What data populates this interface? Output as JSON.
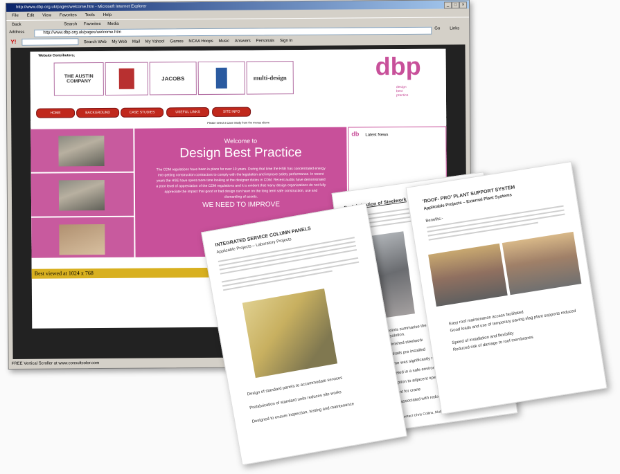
{
  "browser": {
    "title": "http://www.dbp.org.uk/pages/welcome.htm - Microsoft Internet Explorer",
    "menu": [
      "File",
      "Edit",
      "View",
      "Favorites",
      "Tools",
      "Help"
    ],
    "toolbar": [
      "Back",
      "Search",
      "Favorites",
      "Media"
    ],
    "address_label": "Address",
    "address_value": "http://www.dbp.org.uk/pages/welcome.htm",
    "go_label": "Go",
    "links_label": "Links",
    "yahoo_items": [
      "Search Web",
      "My Web",
      "Mail",
      "My Yahoo!",
      "Games",
      "NCAA Hoops",
      "Music",
      "Answers",
      "Personals",
      "Sign In"
    ],
    "status": "FREE Vertical Scroller at www.consultcolor.com"
  },
  "site": {
    "contributors_label": "Website Contributors;",
    "sponsors": [
      "THE AUSTIN COMPANY",
      "JACOBS",
      "multi-design"
    ],
    "dbp_letters": "dbp",
    "dbp_words": [
      "design",
      "best",
      "practice"
    ],
    "nav": [
      "HOME",
      "BACKGROUND",
      "CASE STUDIES",
      "USEFUL LINKS",
      "SITE INFO"
    ],
    "case_study_note": "Please select a Case Study from the menus above",
    "welcome_to": "Welcome to",
    "heading": "Design Best Practice",
    "paragraph": "The CDM regulations have been in place for over 10 years. During that time the HSE has concentrated energy into getting construction contractors to comply with the legislation and improve safety performance. In recent years the HSE have spent more time looking at the designer duties in CDM. Recent audits have demonstrated a poor level of appreciation of the CDM regulations and it is evident that many design organisations do not fully appreciate the impact that good or bad design can have on the long term safe construction, use and dismantling of assets.",
    "improve": "WE NEED TO IMPROVE",
    "latest_news": "Latest News",
    "best_viewed": "Best viewed at 1024 x 768"
  },
  "sheets": {
    "left_title": "INTEGRATED SERVICE COLUMN PANELS",
    "left_subtitle": "Applicable Projects – Laboratory Projects",
    "left_bullets": [
      "Design of standard panels to accommodate services",
      "Prefabrication of standard units reduces site works",
      "Designed to ensure inspection, testing and maintenance"
    ],
    "middle_title": "Prefabrication of Steelwork",
    "middle_intro": "The following points summarise the benefits of the solution.",
    "middle_bullets": [
      "Pre painted finished steelwork",
      "Scaffold handrails pre installed",
      "Installation time was significantly reduced",
      "Works completed in a safe environment",
      "Minimal disruption to adjacent operations",
      "No requirement for crane",
      "Cost savings associated with reduced site time"
    ],
    "middle_footer": "For further details contact Chris Collins, Multi-Design Tel: 0161 477 9730",
    "right_title": "'ROOF- PRO' PLANT SUPPORT SYSTEM",
    "right_subtitle": "Applicable Projects – External Plant Systems",
    "right_benefits": "Benefits:-",
    "right_bullets": [
      "Easy roof maintenance access facilitated",
      "Good loads and use of temporary paving slag plant supports reduced",
      "Speed of installation and flexibility",
      "Reduced risk of damage to roof membranes"
    ]
  },
  "colors": {
    "accent": "#c8509a",
    "nav": "#c0281c",
    "footer": "#d8b020"
  }
}
